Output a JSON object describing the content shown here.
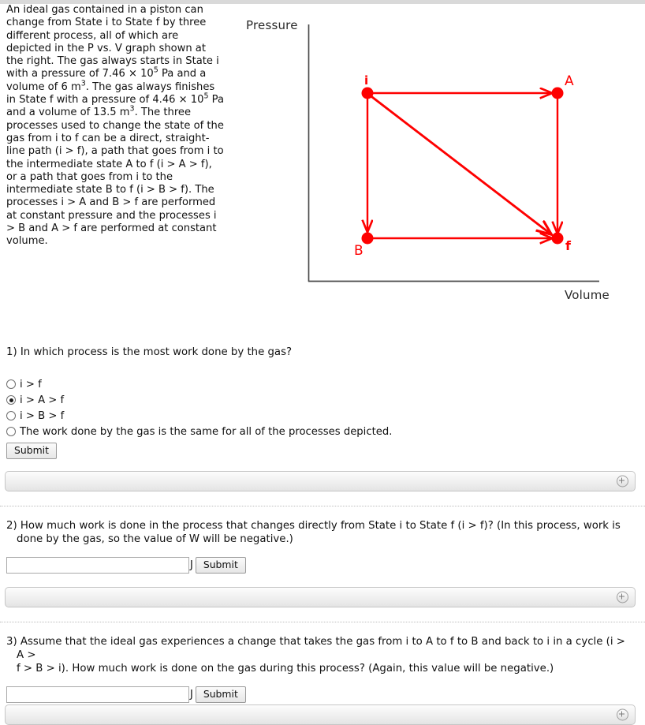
{
  "figure": {
    "y_axis_label": "Pressure",
    "x_axis_label": "Volume",
    "point_labels": {
      "i": "i",
      "A": "A",
      "B": "B",
      "f": "f"
    },
    "accent_color": "#fe0000",
    "axis_color": "#4a4a4a"
  },
  "chart_data": {
    "type": "line",
    "title": "",
    "xlabel": "Volume",
    "ylabel": "Pressure",
    "grid": false,
    "legend": false,
    "points": [
      {
        "name": "i",
        "x": 6,
        "y": 7.46,
        "label_pos": "above-left"
      },
      {
        "name": "A",
        "x": 13.5,
        "y": 7.46,
        "label_pos": "above-right"
      },
      {
        "name": "B",
        "x": 6,
        "y": 4.46,
        "label_pos": "below-left"
      },
      {
        "name": "f",
        "x": 13.5,
        "y": 4.46,
        "label_pos": "below-right"
      }
    ],
    "paths": [
      {
        "from": "i",
        "to": "A",
        "style": "isobaric",
        "arrow": true
      },
      {
        "from": "i",
        "to": "B",
        "style": "isochoric",
        "arrow": true
      },
      {
        "from": "i",
        "to": "f",
        "style": "straight-line",
        "arrow": true
      },
      {
        "from": "A",
        "to": "f",
        "style": "isochoric",
        "arrow": true
      },
      {
        "from": "B",
        "to": "f",
        "style": "isobaric",
        "arrow": true
      }
    ],
    "x_units": "m^3",
    "y_units": "Pa (x 10^5)",
    "xlim": [
      0,
      18
    ],
    "ylim": [
      0,
      10
    ]
  },
  "statement": {
    "part1": "An ideal gas contained in a piston can change from State i to State f by three different process, all of which are depicted in the P vs. V graph shown at the right. The gas always starts in State i with a pressure of 7.46 × 10",
    "exp1": "5",
    "part2": " Pa and a volume of 6 m",
    "exp2": "3",
    "part3": ". The gas always finishes in State f with a pressure of 4.46 × 10",
    "exp3": "5",
    "part4": " Pa and a volume of 13.5 m",
    "exp4": "3",
    "part5": ". The three processes used to change the state of the gas from i to f can be a direct, straight-line path (i > f), a path that goes from i to the intermediate state A to f (i > A > f), or a path that goes from i to the intermediate state B to f (i > B > f). The processes i > A and B > f are performed at constant pressure and the processes i > B and A > f are performed at constant volume."
  },
  "questions": [
    {
      "id": "q1",
      "text": "1) In which process is the most work done by the gas?",
      "choices": [
        {
          "label": "i > f",
          "selected": false
        },
        {
          "label": "i > A > f",
          "selected": true
        },
        {
          "label": "i > B > f",
          "selected": false
        },
        {
          "label": "The work done by the gas is the same for all of the processes depicted.",
          "selected": false
        }
      ],
      "submit_label": "Submit"
    },
    {
      "id": "q2",
      "line1": "2) How much work is done in the process that changes directly from State i to State f (i > f)? (In this process, work is",
      "line2": "done by the gas, so the value of W will be negative.)",
      "input_value": "",
      "input_placeholder": "",
      "unit": "J",
      "submit_label": "Submit"
    },
    {
      "id": "q3",
      "line1": "3) Assume that the ideal gas experiences a change that takes the gas from i to A to f to B and back to i in a cycle (i > A >",
      "line2": "f > B > i). How much work is done on the gas during this process? (Again, this value will be negative.)",
      "input_value": "",
      "input_placeholder": "",
      "unit": "J",
      "submit_label": "Submit"
    }
  ]
}
